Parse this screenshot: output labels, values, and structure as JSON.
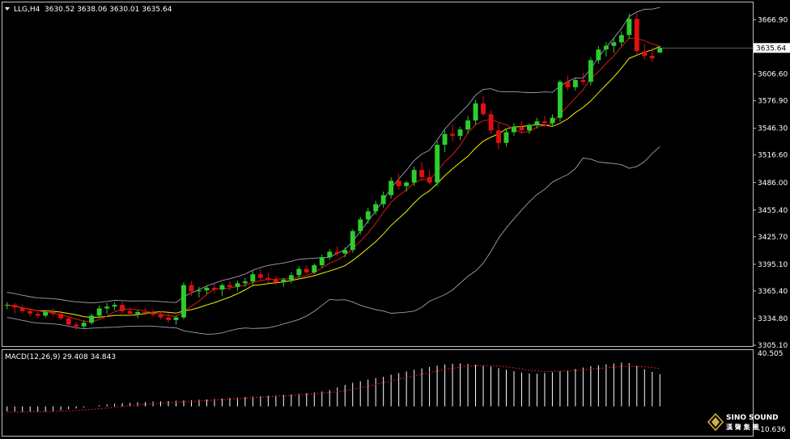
{
  "colors": {
    "background": "#000000",
    "frame": "#c0c0c0",
    "bull_candle": "#2ecc2e",
    "bear_candle": "#e01010",
    "ma_fast": "#e01818",
    "ma_slow": "#f0f000",
    "bollinger": "#9aa0b8",
    "macd_hist": "#ffffff",
    "macd_signal": "#e01818",
    "price_tag_bg": "#ffffff",
    "price_tag_text": "#000000"
  },
  "header": {
    "menu_icon": "triangle-down-icon",
    "symbol": "LLG,H4",
    "ohlc": "3630.52 3638.06 3630.01 3635.64"
  },
  "macd_header": {
    "label": "MACD(12,26,9) 29.408 34.843"
  },
  "logo": {
    "line1": "SINO SOUND",
    "line2": "漢 聲 集 團"
  },
  "chart_data": [
    {
      "type": "candlestick",
      "title": "LLG,H4",
      "ylim": [
        3305.1,
        3680.0
      ],
      "y_ticks": [
        "3666.90",
        "3636.80",
        "3606.60",
        "3576.90",
        "3546.30",
        "3516.60",
        "3486.00",
        "3455.40",
        "3425.70",
        "3395.10",
        "3365.40",
        "3334.80",
        "3305.10"
      ],
      "y_tick_values": [
        3666.9,
        3636.8,
        3606.6,
        3576.9,
        3546.3,
        3516.6,
        3486.0,
        3455.4,
        3425.7,
        3395.1,
        3365.4,
        3334.8,
        3305.1
      ],
      "last_price": "3635.64",
      "last_price_value": 3635.64,
      "candles": [
        [
          3350,
          3353,
          3345,
          3350
        ],
        [
          3350,
          3352,
          3341,
          3347
        ],
        [
          3347,
          3350,
          3340,
          3343
        ],
        [
          3343,
          3346,
          3337,
          3340
        ],
        [
          3340,
          3342,
          3335,
          3338
        ],
        [
          3338,
          3344,
          3336,
          3342
        ],
        [
          3342,
          3346,
          3337,
          3340
        ],
        [
          3340,
          3344,
          3333,
          3335
        ],
        [
          3335,
          3337,
          3325,
          3328
        ],
        [
          3328,
          3331,
          3322,
          3326
        ],
        [
          3326,
          3333,
          3324,
          3330
        ],
        [
          3330,
          3340,
          3328,
          3338
        ],
        [
          3338,
          3349,
          3335,
          3346
        ],
        [
          3346,
          3352,
          3340,
          3348
        ],
        [
          3348,
          3353,
          3344,
          3350
        ],
        [
          3350,
          3354,
          3341,
          3343
        ],
        [
          3343,
          3347,
          3338,
          3340
        ],
        [
          3340,
          3344,
          3335,
          3342
        ],
        [
          3342,
          3346,
          3338,
          3341
        ],
        [
          3341,
          3345,
          3337,
          3339
        ],
        [
          3339,
          3343,
          3334,
          3336
        ],
        [
          3336,
          3341,
          3330,
          3333
        ],
        [
          3333,
          3338,
          3328,
          3336
        ],
        [
          3336,
          3375,
          3334,
          3372
        ],
        [
          3372,
          3376,
          3360,
          3365
        ],
        [
          3365,
          3370,
          3358,
          3366
        ],
        [
          3366,
          3372,
          3362,
          3369
        ],
        [
          3369,
          3374,
          3363,
          3367
        ],
        [
          3367,
          3374,
          3360,
          3372
        ],
        [
          3372,
          3376,
          3366,
          3370
        ],
        [
          3370,
          3377,
          3365,
          3374
        ],
        [
          3374,
          3380,
          3370,
          3376
        ],
        [
          3376,
          3388,
          3372,
          3384
        ],
        [
          3384,
          3390,
          3378,
          3380
        ],
        [
          3380,
          3385,
          3374,
          3378
        ],
        [
          3378,
          3382,
          3372,
          3375
        ],
        [
          3375,
          3380,
          3370,
          3378
        ],
        [
          3378,
          3386,
          3374,
          3383
        ],
        [
          3383,
          3393,
          3380,
          3390
        ],
        [
          3390,
          3394,
          3384,
          3386
        ],
        [
          3386,
          3396,
          3384,
          3394
        ],
        [
          3394,
          3406,
          3391,
          3403
        ],
        [
          3403,
          3412,
          3400,
          3409
        ],
        [
          3409,
          3415,
          3404,
          3407
        ],
        [
          3407,
          3414,
          3403,
          3411
        ],
        [
          3411,
          3434,
          3408,
          3432
        ],
        [
          3432,
          3448,
          3428,
          3445
        ],
        [
          3445,
          3458,
          3440,
          3454
        ],
        [
          3454,
          3466,
          3450,
          3462
        ],
        [
          3462,
          3476,
          3458,
          3472
        ],
        [
          3472,
          3492,
          3468,
          3488
        ],
        [
          3488,
          3496,
          3478,
          3482
        ],
        [
          3482,
          3488,
          3476,
          3486
        ],
        [
          3486,
          3504,
          3482,
          3500
        ],
        [
          3500,
          3509,
          3488,
          3492
        ],
        [
          3492,
          3500,
          3484,
          3486
        ],
        [
          3486,
          3532,
          3482,
          3528
        ],
        [
          3528,
          3544,
          3520,
          3540
        ],
        [
          3540,
          3550,
          3532,
          3538
        ],
        [
          3538,
          3548,
          3533,
          3545
        ],
        [
          3545,
          3560,
          3540,
          3555
        ],
        [
          3555,
          3578,
          3550,
          3574
        ],
        [
          3574,
          3582,
          3560,
          3562
        ],
        [
          3562,
          3566,
          3540,
          3544
        ],
        [
          3544,
          3552,
          3523,
          3530
        ],
        [
          3530,
          3546,
          3526,
          3542
        ],
        [
          3542,
          3552,
          3538,
          3548
        ],
        [
          3548,
          3554,
          3540,
          3544
        ],
        [
          3544,
          3552,
          3540,
          3550
        ],
        [
          3550,
          3558,
          3546,
          3554
        ],
        [
          3554,
          3560,
          3548,
          3552
        ],
        [
          3552,
          3562,
          3548,
          3558
        ],
        [
          3558,
          3600,
          3554,
          3598
        ],
        [
          3598,
          3605,
          3588,
          3592
        ],
        [
          3592,
          3602,
          3588,
          3600
        ],
        [
          3600,
          3608,
          3595,
          3598
        ],
        [
          3598,
          3625,
          3594,
          3622
        ],
        [
          3622,
          3638,
          3618,
          3634
        ],
        [
          3634,
          3642,
          3626,
          3638
        ],
        [
          3638,
          3646,
          3630,
          3642
        ],
        [
          3642,
          3654,
          3638,
          3650
        ],
        [
          3650,
          3674,
          3646,
          3668
        ],
        [
          3668,
          3674,
          3628,
          3632
        ],
        [
          3632,
          3640,
          3623,
          3627
        ],
        [
          3627,
          3636,
          3620,
          3624
        ],
        [
          3630.52,
          3638.06,
          3630.01,
          3635.64
        ]
      ]
    },
    {
      "type": "bar",
      "title": "MACD(12,26,9) 29.408 34.843",
      "ylim": [
        -10.636,
        40.505
      ],
      "y_ticks": [
        "40.505",
        "-10.636"
      ],
      "y_tick_values": [
        40.505,
        -10.636
      ],
      "macd_main": [
        -4.5,
        -4.6,
        -4.9,
        -5.1,
        -5.0,
        -4.8,
        -4.3,
        -3.6,
        -2.6,
        -2.0,
        -1.0,
        0.1,
        1.0,
        1.8,
        2.4,
        2.9,
        3.3,
        3.7,
        4.0,
        4.4,
        4.6,
        4.9,
        5.2,
        5.5,
        5.7,
        6.1,
        6.5,
        6.8,
        7.3,
        7.7,
        8.2,
        8.5,
        9.0,
        9.4,
        9.7,
        10.0,
        10.4,
        10.9,
        11.5,
        12.1,
        12.8,
        13.6,
        15.0,
        17.3,
        19.7,
        21.6,
        23.1,
        24.6,
        26.0,
        27.1,
        29.0,
        30.5,
        32.0,
        33.6,
        34.8,
        36.1,
        37.3,
        38.4,
        39.0,
        39.4,
        38.9,
        38.3,
        37.6,
        36.5,
        35.0,
        33.6,
        32.3,
        31.0,
        30.2,
        29.9,
        30.6,
        31.3,
        32.1,
        33.1,
        34.3,
        35.6,
        36.8,
        37.8,
        38.6,
        39.4,
        40.1,
        39.6,
        37.0,
        34.0,
        31.6,
        29.4
      ],
      "macd_signal": [
        -5.3,
        -5.2,
        -5.2,
        -5.1,
        -5.0,
        -4.9,
        -4.7,
        -4.5,
        -4.2,
        -3.8,
        -3.4,
        -2.8,
        -2.2,
        -1.5,
        -0.8,
        -0.1,
        0.7,
        1.3,
        1.9,
        2.4,
        2.9,
        3.4,
        3.8,
        4.1,
        4.5,
        4.9,
        5.3,
        5.7,
        6.2,
        6.6,
        7.1,
        7.5,
        8.0,
        8.4,
        8.8,
        9.2,
        9.6,
        10.0,
        10.5,
        11.0,
        11.5,
        12.0,
        12.6,
        13.4,
        14.4,
        15.6,
        17.0,
        18.6,
        20.2,
        21.7,
        23.3,
        24.9,
        26.5,
        28.0,
        29.5,
        31.0,
        32.4,
        33.7,
        34.9,
        35.9,
        36.6,
        37.2,
        37.5,
        37.4,
        37.0,
        36.3,
        35.3,
        34.2,
        33.2,
        32.5,
        32.2,
        32.2,
        32.3,
        32.6,
        33.0,
        33.5,
        34.1,
        34.7,
        35.3,
        35.9,
        36.4,
        36.9,
        36.7,
        36.2,
        35.6,
        34.8
      ]
    }
  ]
}
